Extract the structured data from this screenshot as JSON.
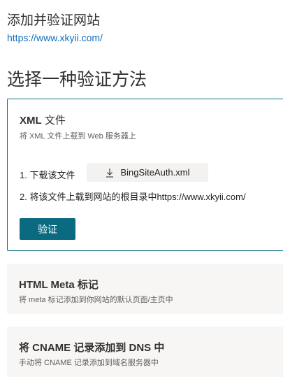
{
  "header": {
    "title": "添加并验证网站",
    "url": "https://www.xkyii.com/"
  },
  "section_title": "选择一种验证方法",
  "methods": [
    {
      "title_prefix": "XML",
      "title_suffix": " 文件",
      "subtitle": "将 XML 文件上载到 Web 服务器上",
      "step1_label": "1. 下载该文件",
      "download_label": "BingSiteAuth.xml",
      "download_icon": "download-icon",
      "step2_label": "2. 将该文件上载到网站的根目录中https://www.xkyii.com/",
      "verify_label": "验证"
    },
    {
      "title": "HTML Meta 标记",
      "subtitle": "将 meta 标记添加到你网站的默认页面/主页中"
    },
    {
      "title": "将 CNAME 记录添加到 DNS 中",
      "subtitle": "手动将 CNAME 记录添加到域名服务器中"
    }
  ],
  "colors": {
    "accent": "#0a6a80",
    "link": "#106ebe",
    "card_border": "#0b7285",
    "collapsed_bg": "#f7f6f5"
  }
}
